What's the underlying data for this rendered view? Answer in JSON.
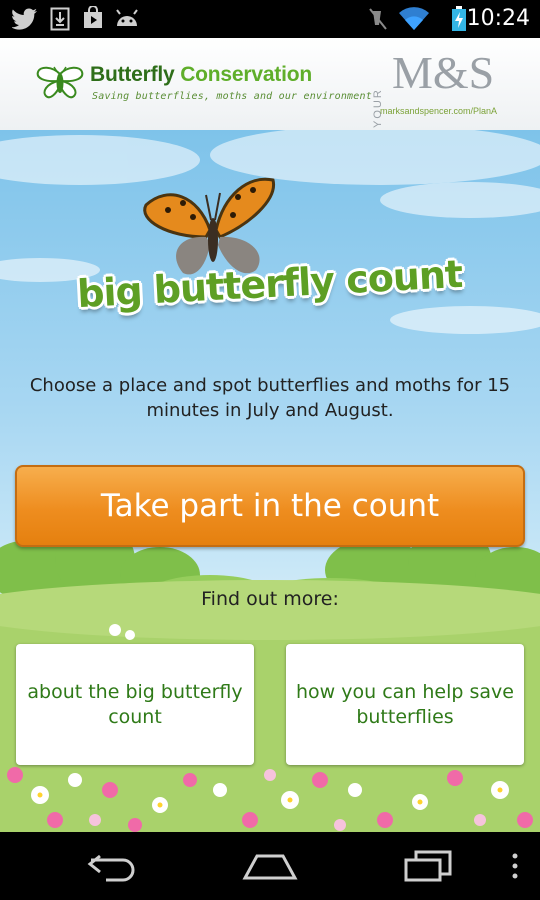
{
  "status_bar": {
    "time": "10:24",
    "left_icons": [
      "twitter-icon",
      "download-icon",
      "play-store-icon",
      "android-icon"
    ],
    "right_icons": [
      "mute-icon",
      "wifi-icon",
      "battery-charging-icon"
    ]
  },
  "header": {
    "bc_name_first": "Butterfly",
    "bc_name_second": "Conservation",
    "bc_tagline": "Saving butterflies, moths and our environment",
    "ms_prefix": "YOUR",
    "ms_mark": "M&S",
    "ms_url": "marksandspencer.com/PlanA"
  },
  "main": {
    "app_title": "big butterfly count",
    "intro": "Choose a place and spot butterflies and moths for 15 minutes in July and August.",
    "cta_label": "Take part in the count",
    "find_out_more": "Find out more:",
    "cards": [
      {
        "label": "about the big butterfly count"
      },
      {
        "label": "how you can help save butterflies"
      }
    ]
  },
  "nav_bar": {
    "icons": [
      "back-icon",
      "home-icon",
      "recent-apps-icon",
      "overflow-menu-icon"
    ]
  },
  "colors": {
    "brand_green": "#3a8a1f",
    "cta_orange": "#ee8d1f",
    "card_text": "#2f7a18"
  }
}
